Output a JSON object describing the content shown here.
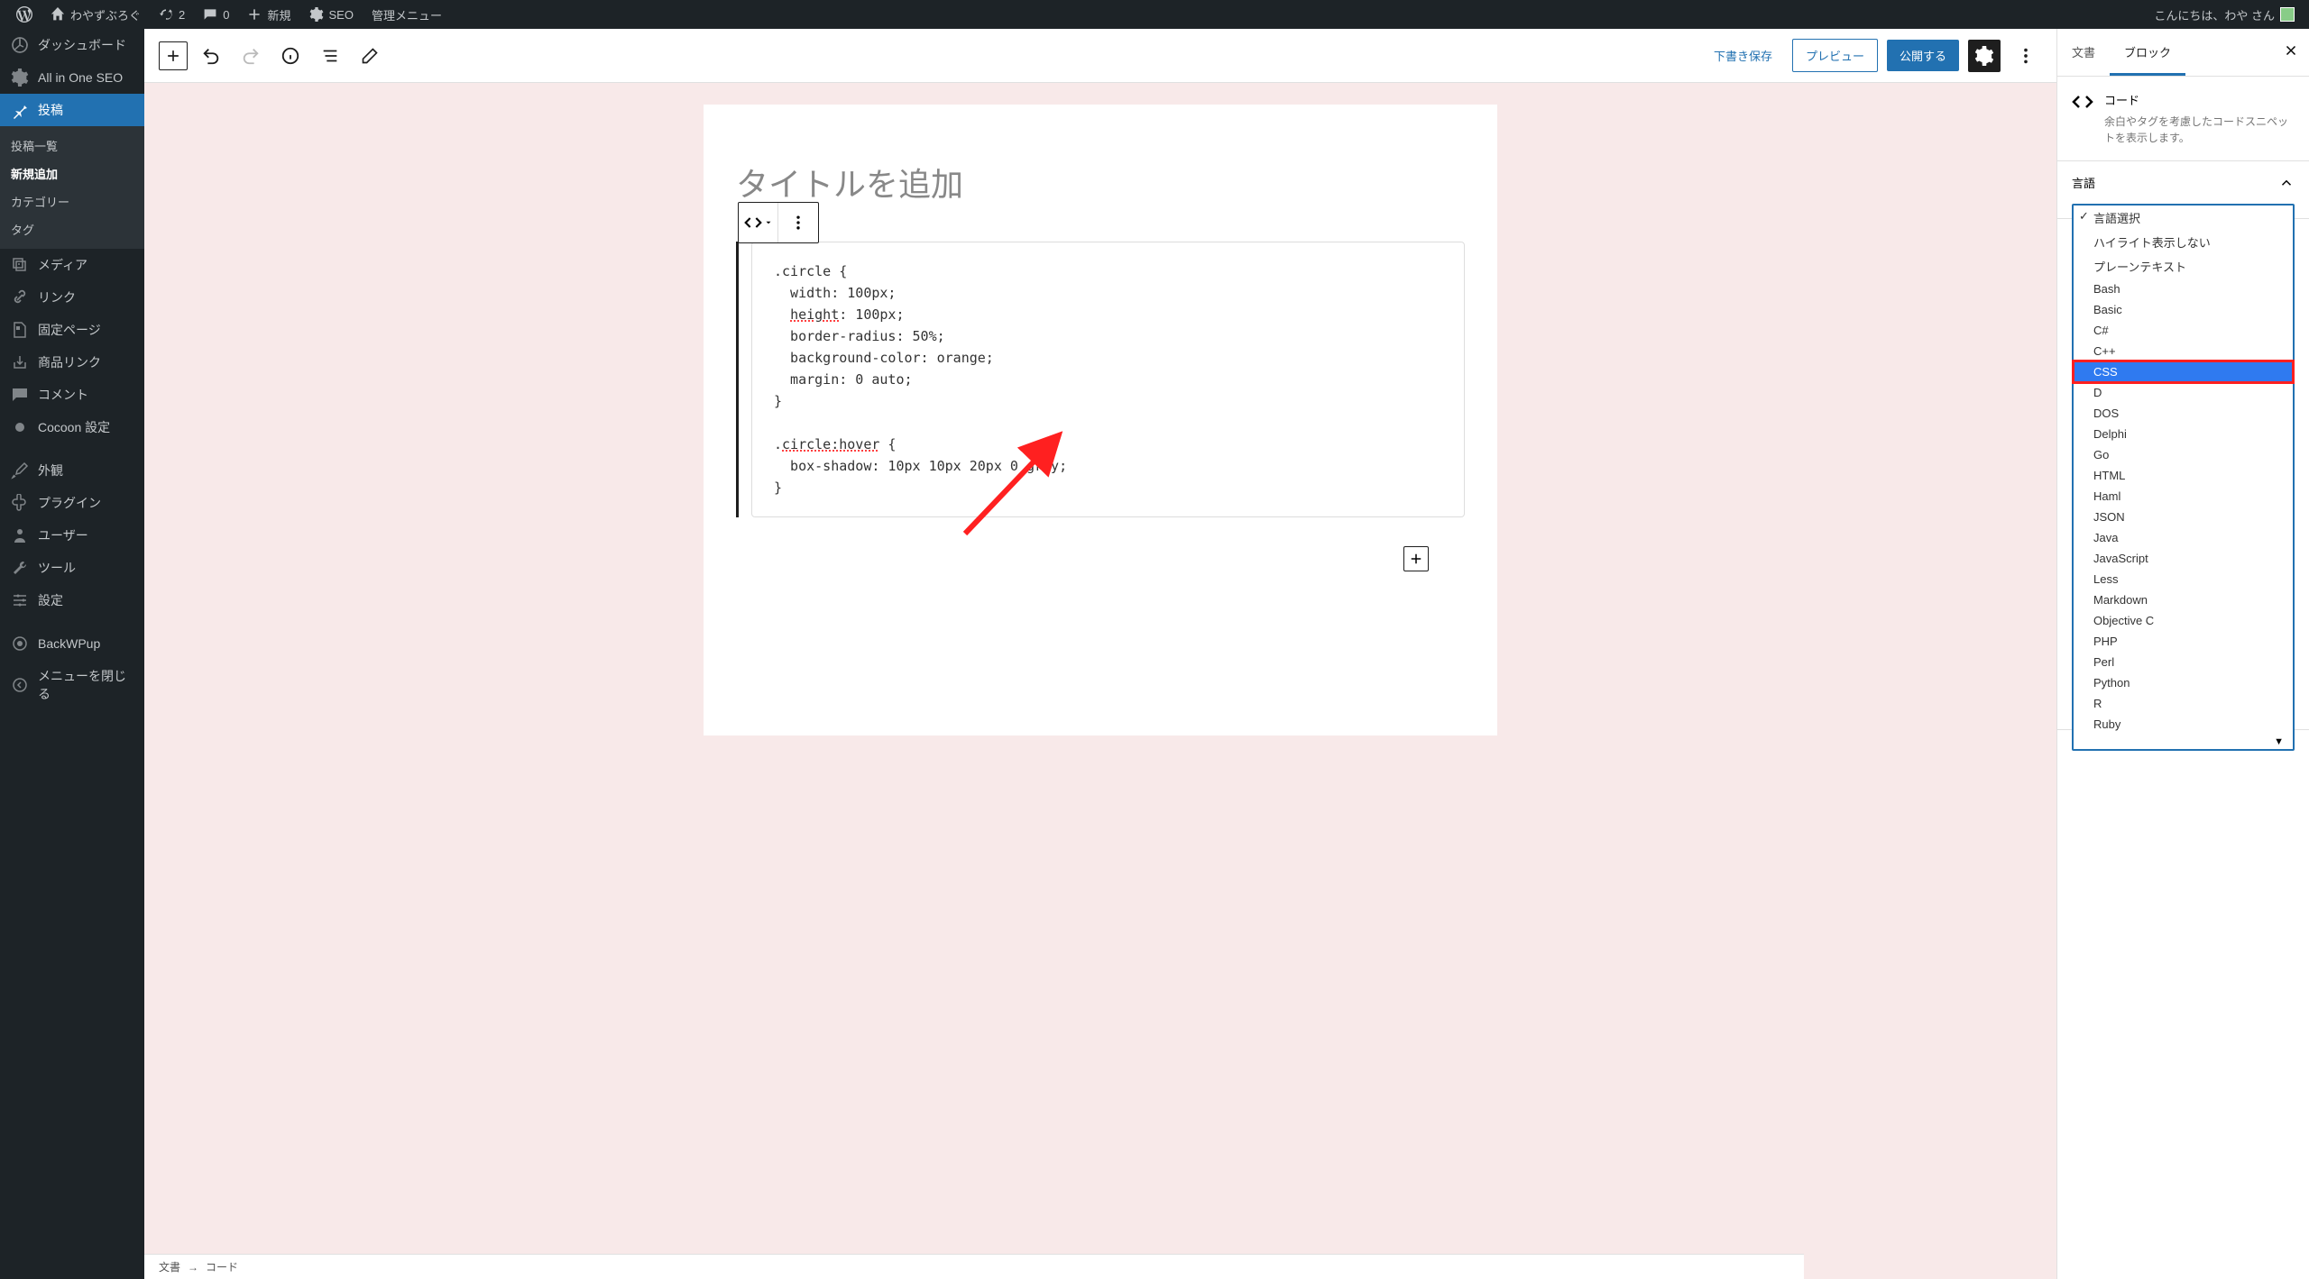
{
  "admin_bar": {
    "site_name": "わやずぶろぐ",
    "updates_count": "2",
    "comments_count": "0",
    "new_label": "新規",
    "seo_label": "SEO",
    "manage_menu": "管理メニュー",
    "greeting": "こんにちは、わや さん"
  },
  "sidebar": {
    "dashboard": "ダッシュボード",
    "aioseo": "All in One SEO",
    "posts": "投稿",
    "posts_sub": {
      "list": "投稿一覧",
      "new": "新規追加",
      "categories": "カテゴリー",
      "tags": "タグ"
    },
    "media": "メディア",
    "links": "リンク",
    "pages": "固定ページ",
    "product_links": "商品リンク",
    "comments": "コメント",
    "cocoon": "Cocoon 設定",
    "appearance": "外観",
    "plugins": "プラグイン",
    "users": "ユーザー",
    "tools": "ツール",
    "settings": "設定",
    "backwpup": "BackWPup",
    "collapse": "メニューを閉じる"
  },
  "toolbar": {
    "save_draft": "下書き保存",
    "preview": "プレビュー",
    "publish": "公開する"
  },
  "editor": {
    "title_placeholder": "タイトルを追加",
    "code_lines": [
      ".circle {",
      "  width: 100px;",
      "  height: 100px;",
      "  border-radius: 50%;",
      "  background-color: orange;",
      "  margin: 0 auto;",
      "}",
      "",
      ".circle:hover {",
      "  box-shadow: 10px 10px 20px 0 grey;",
      "}"
    ]
  },
  "breadcrumb": {
    "doc": "文書",
    "code": "コード"
  },
  "panel": {
    "tab_doc": "文書",
    "tab_block": "ブロック",
    "block_name": "コード",
    "block_desc": "余白やタグを考慮したコードスニペットを表示します。",
    "section_language": "言語",
    "language_options": [
      "言語選択",
      "ハイライト表示しない",
      "プレーンテキスト",
      "Bash",
      "Basic",
      "C#",
      "C++",
      "CSS",
      "D",
      "DOS",
      "Delphi",
      "Go",
      "HTML",
      "Haml",
      "JSON",
      "Java",
      "JavaScript",
      "Less",
      "Markdown",
      "Objective C",
      "PHP",
      "Perl",
      "Python",
      "R",
      "Ruby"
    ],
    "checked_index": 0,
    "highlighted_index": 7
  }
}
